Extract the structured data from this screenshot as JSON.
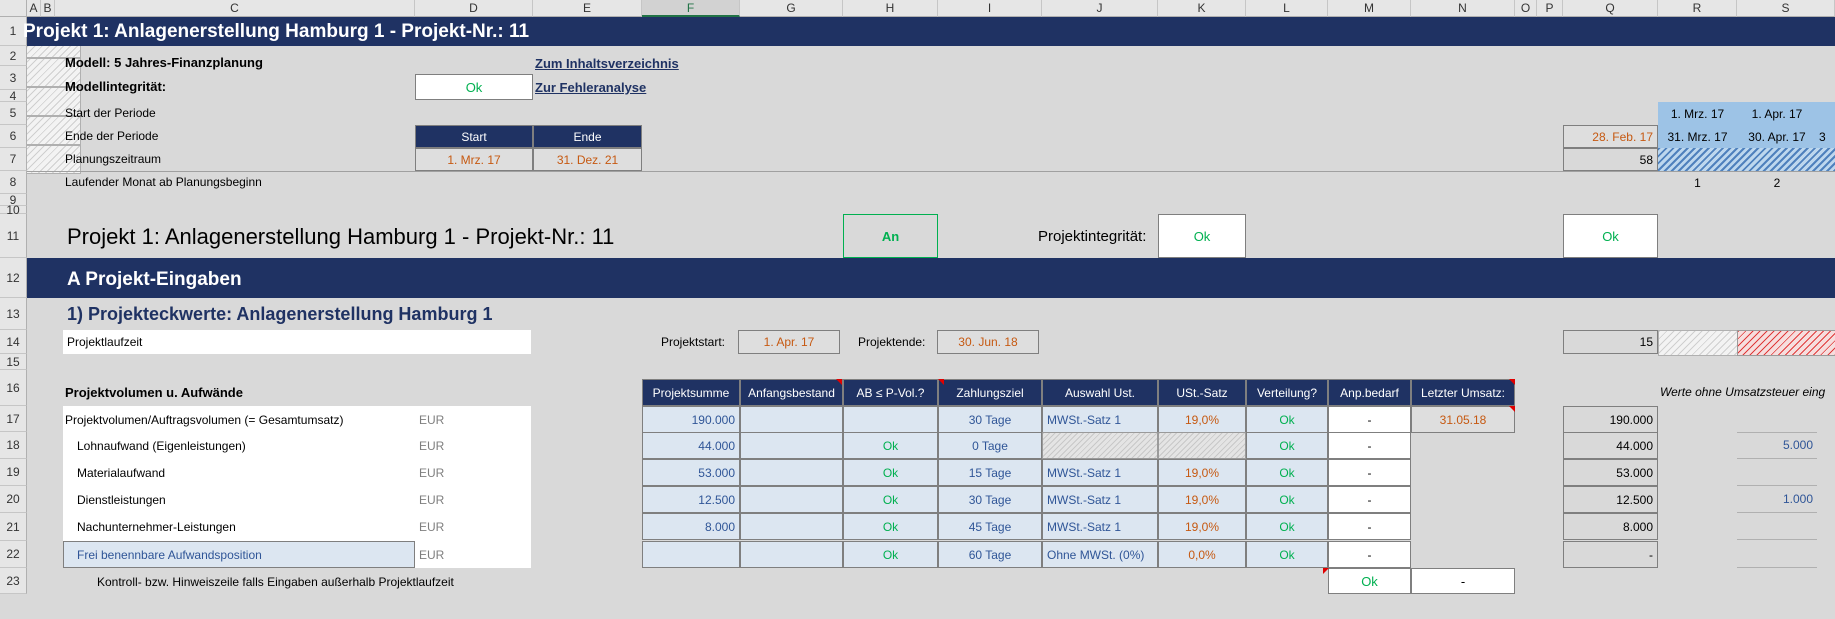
{
  "columns": [
    "A",
    "B",
    "C",
    "D",
    "E",
    "F",
    "G",
    "H",
    "I",
    "J",
    "K",
    "L",
    "M",
    "N",
    "O",
    "P",
    "Q",
    "R",
    "S"
  ],
  "rows": [
    "1",
    "2",
    "3",
    "4",
    "5",
    "6",
    "7",
    "8",
    "9",
    "10",
    "11",
    "12",
    "13",
    "14",
    "15",
    "16",
    "17",
    "18",
    "19",
    "20",
    "21",
    "22",
    "23"
  ],
  "header": {
    "title": "Projekt 1: Anlagenerstellung Hamburg 1 - Projekt-Nr.: 11"
  },
  "model": {
    "label": "Modell: 5 Jahres-Finanzplanung",
    "integrity_label": "Modellintegrität:",
    "integrity_value": "Ok",
    "toc_link": "Zum Inhaltsverzeichnis",
    "error_link": "Zur Fehleranalyse"
  },
  "period": {
    "start_label": "Start der Periode",
    "end_label": "Ende der Periode",
    "planning_label": "Planungszeitraum",
    "running_label": "Laufender Monat ab Planungsbeginn",
    "start_header": "Start",
    "end_header": "Ende",
    "start_value": "1. Mrz. 17",
    "end_value": "31. Dez. 21",
    "q_end": "28. Feb. 17",
    "q_count": "58",
    "timeline": [
      {
        "start": "1. Mrz. 17",
        "end": "31. Mrz. 17",
        "month": "1"
      },
      {
        "start": "1. Apr. 17",
        "end": "30. Apr. 17",
        "month": "2"
      }
    ],
    "timeline_overflow": "3"
  },
  "project": {
    "title": "Projekt 1: Anlagenerstellung Hamburg 1 - Projekt-Nr.: 11",
    "switch_value": "An",
    "integrity_label": "Projektintegrität:",
    "integrity_value": "Ok",
    "q_integrity": "Ok"
  },
  "section_a": {
    "title": "A  Projekt-Eingaben"
  },
  "subsection": {
    "title": "1) Projekteckwerte: Anlagenerstellung Hamburg 1"
  },
  "runtime": {
    "label": "Projektlaufzeit",
    "start_label": "Projektstart:",
    "start_value": "1. Apr. 17",
    "end_label": "Projektende:",
    "end_value": "30. Jun. 18",
    "q_value": "15"
  },
  "volume": {
    "section_label": "Projektvolumen u. Aufwände",
    "note": "Werte ohne Umsatzsteuer eing",
    "columns": [
      "Projektsumme",
      "Anfangsbestand",
      "AB ≤ P-Vol.?",
      "Zahlungsziel",
      "Auswahl Ust.",
      "USt.-Satz",
      "Verteilung?",
      "Anp.bedarf",
      "Letzter Umsatz:"
    ],
    "rows": [
      {
        "label": "Projektvolumen/Auftragsvolumen (= Gesamtumsatz)",
        "unit": "EUR",
        "summe": "190.000",
        "ab": "",
        "ok": "",
        "ziel": "30 Tage",
        "ust": "MWSt.-Satz 1",
        "satz": "19,0%",
        "vert": "Ok",
        "anp": "-",
        "letzter": "31.05.18",
        "q": "190.000",
        "s": ""
      },
      {
        "label": "Lohnaufwand (Eigenleistungen)",
        "unit": "EUR",
        "summe": "44.000",
        "ab": "",
        "ok": "Ok",
        "ziel": "0 Tage",
        "ust": "",
        "satz": "",
        "vert": "Ok",
        "anp": "-",
        "letzter": "",
        "q": "44.000",
        "s": "5.000"
      },
      {
        "label": "Materialaufwand",
        "unit": "EUR",
        "summe": "53.000",
        "ab": "",
        "ok": "Ok",
        "ziel": "15 Tage",
        "ust": "MWSt.-Satz 1",
        "satz": "19,0%",
        "vert": "Ok",
        "anp": "-",
        "letzter": "",
        "q": "53.000",
        "s": ""
      },
      {
        "label": "Dienstleistungen",
        "unit": "EUR",
        "summe": "12.500",
        "ab": "",
        "ok": "Ok",
        "ziel": "30 Tage",
        "ust": "MWSt.-Satz 1",
        "satz": "19,0%",
        "vert": "Ok",
        "anp": "-",
        "letzter": "",
        "q": "12.500",
        "s": "1.000"
      },
      {
        "label": "Nachunternehmer-Leistungen",
        "unit": "EUR",
        "summe": "8.000",
        "ab": "",
        "ok": "Ok",
        "ziel": "45 Tage",
        "ust": "MWSt.-Satz 1",
        "satz": "19,0%",
        "vert": "Ok",
        "anp": "-",
        "letzter": "",
        "q": "8.000",
        "s": ""
      },
      {
        "label": "Frei benennbare Aufwandsposition",
        "unit": "EUR",
        "summe": "",
        "ab": "",
        "ok": "Ok",
        "ziel": "60 Tage",
        "ust": "Ohne MWSt. (0%)",
        "satz": "0,0%",
        "vert": "Ok",
        "anp": "-",
        "letzter": "",
        "q": "-",
        "s": ""
      }
    ],
    "control_label": "Kontroll- bzw. Hinweiszeile falls Eingaben außerhalb Projektlaufzeit",
    "control_ok": "Ok",
    "control_dash": "-"
  }
}
